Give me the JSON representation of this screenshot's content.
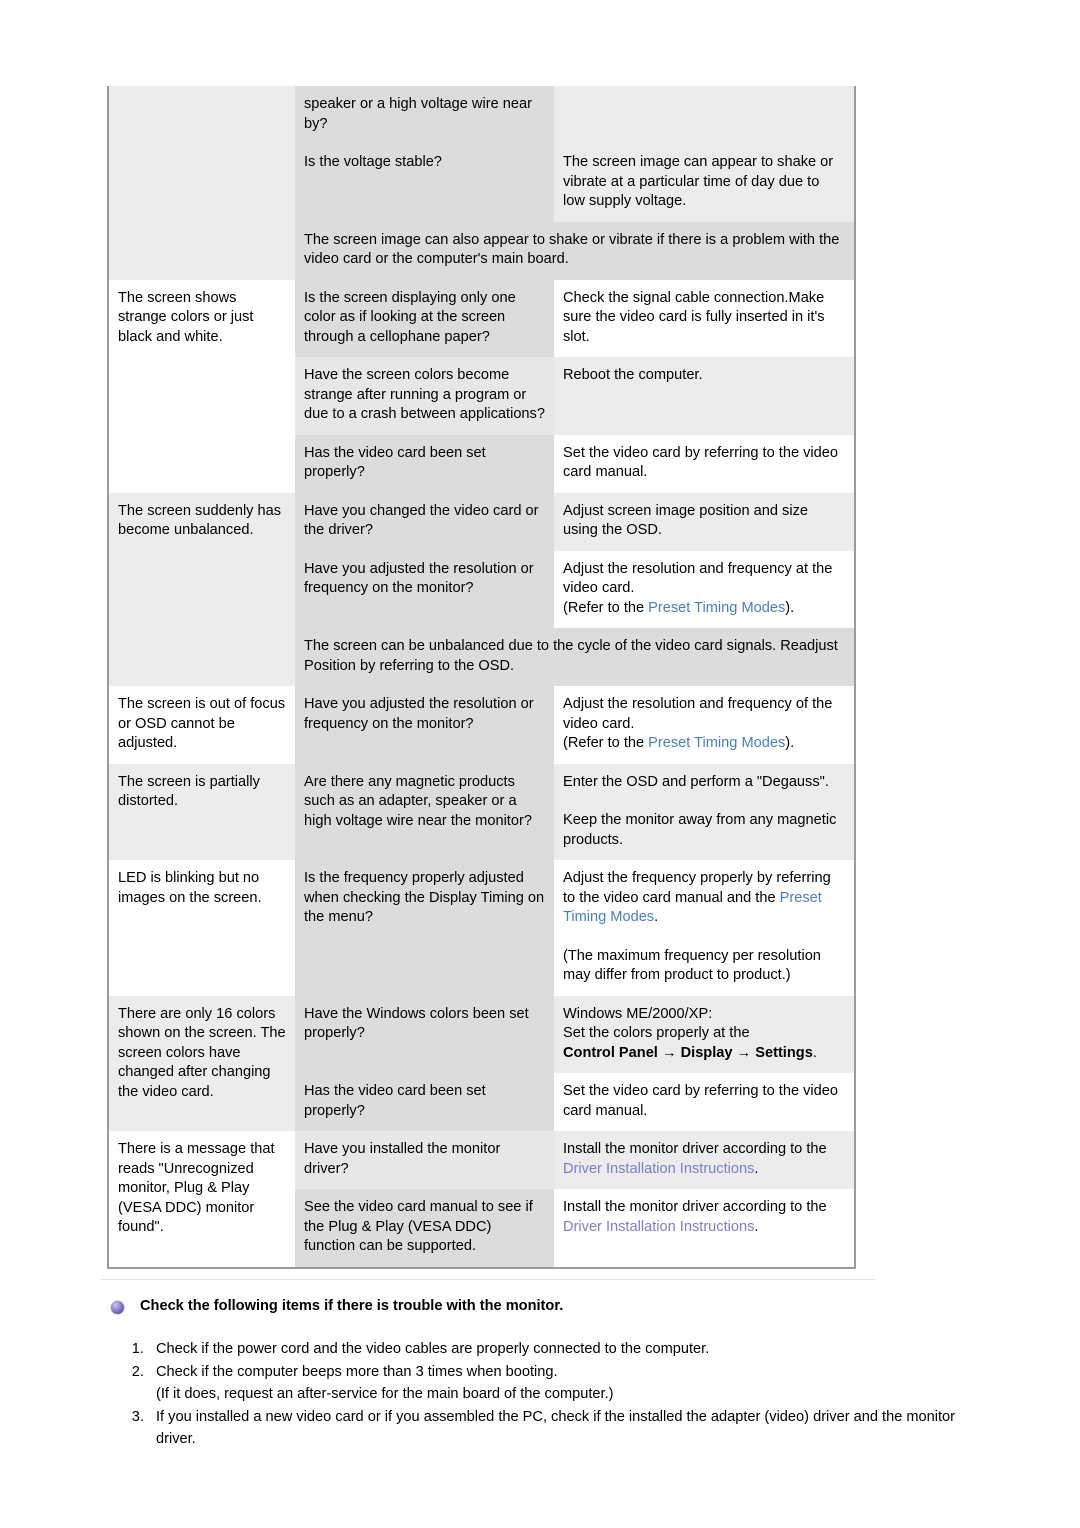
{
  "colors": {
    "link_primary": "#4a7ebb",
    "link_secondary": "#7b7ec8",
    "band_light": "#ececec",
    "band_mid": "#dcdcdc",
    "table_border": "#9a9a9a",
    "bullet": "#5b52a8"
  },
  "table": {
    "rows": [
      {
        "symptom": "",
        "check": "speaker or a high voltage wire near by?",
        "solution": ""
      },
      {
        "symptom": "",
        "check": "Is the voltage stable?",
        "solution": "The screen image can appear to shake or vibrate at a particular time of day due to low supply voltage."
      },
      {
        "symptom": "",
        "full": "The screen image can also appear to shake or vibrate if there is a problem with the video card or the computer's main board."
      },
      {
        "symptom": "The screen shows strange colors or just black and white.",
        "check": "Is the screen displaying only one color as if looking at the screen through a cellophane paper?",
        "solution": "Check the signal cable connection.Make sure the video card is fully inserted in it's slot."
      },
      {
        "check": "Have the screen colors become strange after running a program or due to a crash between applications?",
        "solution": "Reboot the computer."
      },
      {
        "check": "Has the video card been set properly?",
        "solution": "Set the video card by referring to the video card manual."
      },
      {
        "symptom": "The screen suddenly has become unbalanced.",
        "check": "Have you changed the video card or the driver?",
        "solution": "Adjust screen image position and size using the OSD."
      },
      {
        "check": "Have you adjusted the resolution or frequency on the monitor?",
        "solution_pre": "Adjust the resolution and frequency at the video card.",
        "solution_refer_pre": "(Refer to the ",
        "solution_link": "Preset Timing Modes",
        "solution_refer_post": ")."
      },
      {
        "full": "The screen can be unbalanced due to the cycle of the video card signals. Readjust Position by referring to the OSD."
      },
      {
        "symptom": "The screen is out of focus or OSD cannot be adjusted.",
        "check": "Have you adjusted the resolution or frequency on the monitor?",
        "solution_pre": "Adjust the resolution and frequency of the video card.",
        "solution_refer_pre": "(Refer to the ",
        "solution_link": "Preset Timing Modes",
        "solution_refer_post": ")."
      },
      {
        "symptom": "The screen is partially distorted.",
        "check": "Are there any magnetic products such as an adapter, speaker or a high voltage wire near the monitor?",
        "solution_pre": "Enter the OSD and perform a \"Degauss\".",
        "solution_post": "Keep the monitor away from any magnetic products."
      },
      {
        "symptom": "LED is blinking but no images on the screen.",
        "check": "Is the frequency properly adjusted when checking the Display Timing on the menu?",
        "solution_pre": "Adjust the frequency properly by referring to the video card manual and the ",
        "solution_link": "Preset Timing Modes",
        "solution_mid": ".",
        "solution_post": "(The maximum frequency per resolution may differ from product to product.)"
      },
      {
        "symptom": "There are only 16 colors shown on the screen.\nThe screen colors have changed after changing the video card.",
        "check": "Have the Windows colors been set properly?",
        "solution_l1": "Windows ME/2000/XP:",
        "solution_l2": "Set the colors properly at the",
        "solution_bold1": "Control Panel",
        "solution_arrow1": "→",
        "solution_bold2": "Display",
        "solution_arrow2": "→",
        "solution_bold3": "Settings",
        "solution_period": "."
      },
      {
        "check": "Has the video card been set properly?",
        "solution": "Set the video card by referring to the video card manual."
      },
      {
        "symptom": "There is a message that reads \"Unrecognized monitor, Plug & Play (VESA DDC) monitor found\".",
        "check": "Have you installed the monitor driver?",
        "solution_pre": "Install the monitor driver according to the ",
        "solution_link": "Driver Installation Instructions",
        "solution_post": "."
      },
      {
        "check": "See the video card manual to see if the Plug & Play (VESA DDC) function can be supported.",
        "solution_pre": "Install the monitor driver according to the ",
        "solution_link": "Driver Installation Instructions",
        "solution_post": "."
      }
    ]
  },
  "footer": {
    "heading": "Check the following items if there is trouble with the monitor.",
    "items": [
      {
        "text": "Check if the power cord and the video cables are properly connected to the computer."
      },
      {
        "text": "Check if the computer beeps more than 3 times when booting.",
        "sub": "(If it does, request an after-service for the main board of the computer.)"
      },
      {
        "text": "If you installed a new video card or if you assembled the PC, check if the installed the adapter (video) driver and the monitor driver."
      }
    ]
  }
}
